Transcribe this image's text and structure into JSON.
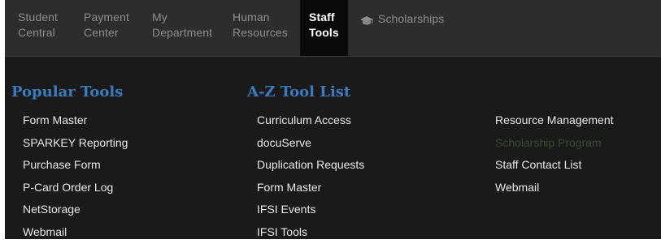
{
  "nav": {
    "items": [
      {
        "line1": "Student",
        "line2": "Central"
      },
      {
        "line1": "Payment",
        "line2": "Center"
      },
      {
        "line1": "My",
        "line2": "Department"
      },
      {
        "line1": "Human",
        "line2": "Resources"
      },
      {
        "line1": "Staff",
        "line2": "Tools"
      }
    ],
    "scholarships": {
      "label": "Scholarships",
      "icon": "graduation-cap-icon"
    },
    "active_index": 4
  },
  "popular_tools": {
    "heading": "Popular Tools",
    "links": [
      "Form Master",
      "SPARKEY Reporting",
      "Purchase Form",
      "P-Card Order Log",
      "NetStorage",
      "Webmail"
    ]
  },
  "az_tool_list": {
    "heading": "A-Z Tool List",
    "column1": [
      "Curriculum Access",
      "docuServe",
      "Duplication Requests",
      "Form Master",
      "IFSI Events",
      "IFSI Tools"
    ],
    "column2": [
      "Resource Management",
      "Scholarship Program",
      "Staff Contact List",
      "Webmail"
    ]
  },
  "colors": {
    "nav_bg": "#2d2d2d",
    "panel_bg": "#1a1a1a",
    "active_tab_bg": "#0a0a0a",
    "heading": "#3b7bbf",
    "link": "#e8e8e8",
    "muted_link": "#3b4a37"
  }
}
